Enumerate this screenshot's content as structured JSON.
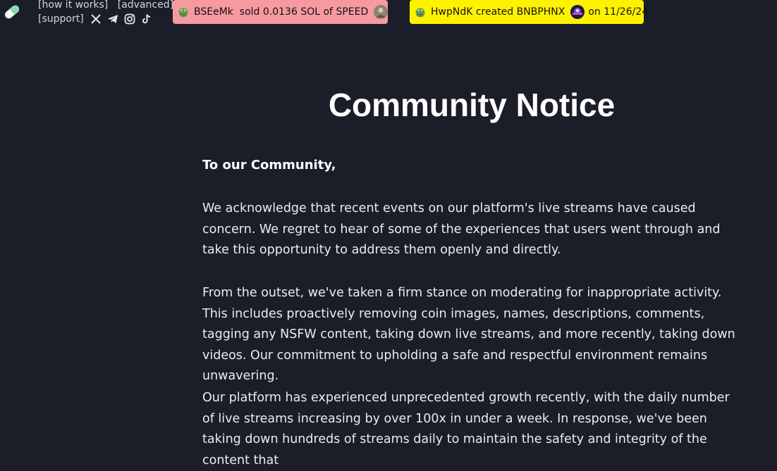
{
  "header": {
    "logo_name": "pill-logo",
    "nav": {
      "how_it_works": "[how it works]",
      "advanced": "[advanced]",
      "support": "[support]"
    },
    "social_icons": [
      "x-icon",
      "telegram-icon",
      "instagram-icon",
      "tiktok-icon"
    ]
  },
  "tickers": {
    "sell": {
      "user": "BSEeMk",
      "action": "sold 0.0136 SOL of",
      "token": "SPEED",
      "color": "#f79aa0"
    },
    "create": {
      "user": "HwpNdK",
      "action": "created",
      "token": "BNBPHNX",
      "date_prefix": "on",
      "date": "11/26/24",
      "color": "#fff200"
    }
  },
  "notice": {
    "title": "Community Notice",
    "greeting": "To our Community,",
    "paragraphs": [
      "We acknowledge that recent events on our platform's live streams have caused concern. We regret to hear of some of the experiences that users went through and take this opportunity to address them openly and directly.",
      "From the outset, we've taken a firm stance on moderating for inappropriate activity. This includes proactively removing coin images, names, descriptions, comments, tagging any NSFW content, taking down live streams, and more recently, taking down videos. Our commitment to upholding a safe and respectful environment remains unwavering.",
      "Our platform has experienced unprecedented growth recently, with the daily number of live streams increasing by over 100x in under a week. In response, we've been taking down hundreds of streams daily to maintain the safety and integrity of the content that"
    ]
  },
  "colors": {
    "background": "#1b1d28",
    "text": "#ffffff"
  }
}
